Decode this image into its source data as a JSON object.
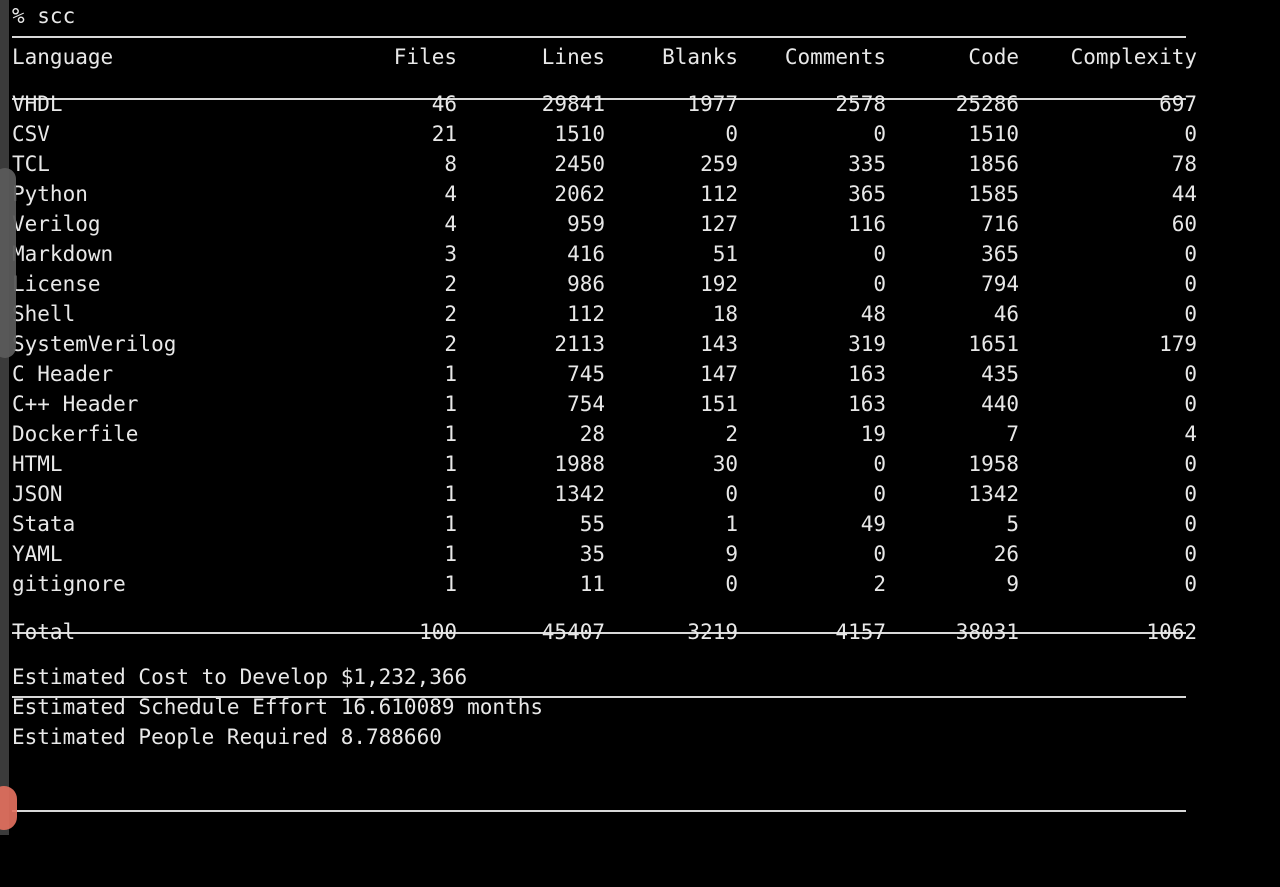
{
  "terminal": {
    "prompt_symbol": "%",
    "command": "scc",
    "prompt_line": "% scc",
    "background_color": "#000000",
    "foreground_color": "#e8e8e8",
    "rule_color": "#d8d8d8",
    "gutter_color": "#3b3b3b",
    "scrollbar_thumb_color": "#5a5a5a",
    "resize_handle_color": "#e2705e"
  },
  "table": {
    "headers": {
      "language": "Language",
      "files": "Files",
      "lines": "Lines",
      "blanks": "Blanks",
      "comments": "Comments",
      "code": "Code",
      "complexity": "Complexity"
    },
    "rows": [
      {
        "language": "VHDL",
        "files": "46",
        "lines": "29841",
        "blanks": "1977",
        "comments": "2578",
        "code": "25286",
        "complexity": "697"
      },
      {
        "language": "CSV",
        "files": "21",
        "lines": "1510",
        "blanks": "0",
        "comments": "0",
        "code": "1510",
        "complexity": "0"
      },
      {
        "language": "TCL",
        "files": "8",
        "lines": "2450",
        "blanks": "259",
        "comments": "335",
        "code": "1856",
        "complexity": "78"
      },
      {
        "language": "Python",
        "files": "4",
        "lines": "2062",
        "blanks": "112",
        "comments": "365",
        "code": "1585",
        "complexity": "44"
      },
      {
        "language": "Verilog",
        "files": "4",
        "lines": "959",
        "blanks": "127",
        "comments": "116",
        "code": "716",
        "complexity": "60"
      },
      {
        "language": "Markdown",
        "files": "3",
        "lines": "416",
        "blanks": "51",
        "comments": "0",
        "code": "365",
        "complexity": "0"
      },
      {
        "language": "License",
        "files": "2",
        "lines": "986",
        "blanks": "192",
        "comments": "0",
        "code": "794",
        "complexity": "0"
      },
      {
        "language": "Shell",
        "files": "2",
        "lines": "112",
        "blanks": "18",
        "comments": "48",
        "code": "46",
        "complexity": "0"
      },
      {
        "language": "SystemVerilog",
        "files": "2",
        "lines": "2113",
        "blanks": "143",
        "comments": "319",
        "code": "1651",
        "complexity": "179"
      },
      {
        "language": "C Header",
        "files": "1",
        "lines": "745",
        "blanks": "147",
        "comments": "163",
        "code": "435",
        "complexity": "0"
      },
      {
        "language": "C++ Header",
        "files": "1",
        "lines": "754",
        "blanks": "151",
        "comments": "163",
        "code": "440",
        "complexity": "0"
      },
      {
        "language": "Dockerfile",
        "files": "1",
        "lines": "28",
        "blanks": "2",
        "comments": "19",
        "code": "7",
        "complexity": "4"
      },
      {
        "language": "HTML",
        "files": "1",
        "lines": "1988",
        "blanks": "30",
        "comments": "0",
        "code": "1958",
        "complexity": "0"
      },
      {
        "language": "JSON",
        "files": "1",
        "lines": "1342",
        "blanks": "0",
        "comments": "0",
        "code": "1342",
        "complexity": "0"
      },
      {
        "language": "Stata",
        "files": "1",
        "lines": "55",
        "blanks": "1",
        "comments": "49",
        "code": "5",
        "complexity": "0"
      },
      {
        "language": "YAML",
        "files": "1",
        "lines": "35",
        "blanks": "9",
        "comments": "0",
        "code": "26",
        "complexity": "0"
      },
      {
        "language": "gitignore",
        "files": "1",
        "lines": "11",
        "blanks": "0",
        "comments": "2",
        "code": "9",
        "complexity": "0"
      }
    ],
    "total": {
      "language": "Total",
      "files": "100",
      "lines": "45407",
      "blanks": "3219",
      "comments": "4157",
      "code": "38031",
      "complexity": "1062"
    }
  },
  "summary": {
    "cost_label": "Estimated Cost to Develop",
    "cost_value": "$1,232,366",
    "cost_line": "Estimated Cost to Develop $1,232,366",
    "schedule_label": "Estimated Schedule Effort",
    "schedule_value": "16.610089 months",
    "schedule_line": "Estimated Schedule Effort 16.610089 months",
    "people_label": "Estimated People Required",
    "people_value": "8.788660",
    "people_line": "Estimated People Required 8.788660"
  }
}
